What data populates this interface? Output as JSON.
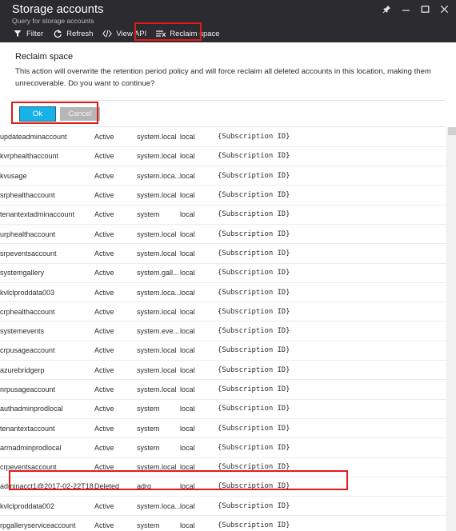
{
  "window": {
    "title": "Storage accounts",
    "subtitle": "Query for storage accounts",
    "controls": [
      {
        "name": "pin-icon",
        "label": "Pin"
      },
      {
        "name": "minimize-icon",
        "label": "Minimize"
      },
      {
        "name": "maximize-icon",
        "label": "Maximize"
      },
      {
        "name": "close-icon",
        "label": "Close"
      }
    ]
  },
  "toolbar": {
    "filter_label": "Filter",
    "refresh_label": "Refresh",
    "view_api_label": "View API",
    "reclaim_space_label": "Reclaim space"
  },
  "confirm": {
    "title": "Reclaim space",
    "message": "This action will overwrite the retention period policy and will force reclaim all deleted accounts in this location, making them unrecoverable. Do you want to continue?",
    "ok_label": "Ok",
    "cancel_label": "Cancel"
  },
  "colors": {
    "titlebar_bg": "#2b2b30",
    "ok_button": "#17b3e8",
    "cancel_button": "#b6b6b6",
    "annotation_red": "#e01b1b",
    "row_border": "#ececec"
  },
  "table": {
    "subscription_placeholder": "{Subscription ID}",
    "rows": [
      {
        "name": "updateadminaccount",
        "status": "Active",
        "group": "system.local",
        "location": "local",
        "subscription": "{Subscription ID}",
        "highlighted": false
      },
      {
        "name": "kvrphealthaccount",
        "status": "Active",
        "group": "system.local",
        "location": "local",
        "subscription": "{Subscription ID}",
        "highlighted": false
      },
      {
        "name": "kvusage",
        "status": "Active",
        "group": "system.loca...",
        "location": "local",
        "subscription": "{Subscription ID}",
        "highlighted": false
      },
      {
        "name": "srphealthaccount",
        "status": "Active",
        "group": "system.local",
        "location": "local",
        "subscription": "{Subscription ID}",
        "highlighted": false
      },
      {
        "name": "tenantextadminaccount",
        "status": "Active",
        "group": "system",
        "location": "local",
        "subscription": "{Subscription ID}",
        "highlighted": false
      },
      {
        "name": "urphealthaccount",
        "status": "Active",
        "group": "system.local",
        "location": "local",
        "subscription": "{Subscription ID}",
        "highlighted": false
      },
      {
        "name": "srpeventsaccount",
        "status": "Active",
        "group": "system.local",
        "location": "local",
        "subscription": "{Subscription ID}",
        "highlighted": false
      },
      {
        "name": "systemgallery",
        "status": "Active",
        "group": "system.gall...",
        "location": "local",
        "subscription": "{Subscription ID}",
        "highlighted": false
      },
      {
        "name": "kvlclproddata003",
        "status": "Active",
        "group": "system.loca...",
        "location": "local",
        "subscription": "{Subscription ID}",
        "highlighted": false
      },
      {
        "name": "crphealthaccount",
        "status": "Active",
        "group": "system.local",
        "location": "local",
        "subscription": "{Subscription ID}",
        "highlighted": false
      },
      {
        "name": "systemevents",
        "status": "Active",
        "group": "system.eve...",
        "location": "local",
        "subscription": "{Subscription ID}",
        "highlighted": false
      },
      {
        "name": "crpusageaccount",
        "status": "Active",
        "group": "system.local",
        "location": "local",
        "subscription": "{Subscription ID}",
        "highlighted": false
      },
      {
        "name": "azurebridgerp",
        "status": "Active",
        "group": "system.local",
        "location": "local",
        "subscription": "{Subscription ID}",
        "highlighted": false
      },
      {
        "name": "nrpusageaccount",
        "status": "Active",
        "group": "system.local",
        "location": "local",
        "subscription": "{Subscription ID}",
        "highlighted": false
      },
      {
        "name": "authadminprodlocal",
        "status": "Active",
        "group": "system",
        "location": "local",
        "subscription": "{Subscription ID}",
        "highlighted": false
      },
      {
        "name": "tenantextaccount",
        "status": "Active",
        "group": "system",
        "location": "local",
        "subscription": "{Subscription ID}",
        "highlighted": false
      },
      {
        "name": "armadminprodlocal",
        "status": "Active",
        "group": "system",
        "location": "local",
        "subscription": "{Subscription ID}",
        "highlighted": false
      },
      {
        "name": "crpeventsaccount",
        "status": "Active",
        "group": "system.local",
        "location": "local",
        "subscription": "{Subscription ID}",
        "highlighted": false
      },
      {
        "name": "adminacct1@2017-02-22T18...",
        "status": "Deleted",
        "group": "adrg",
        "location": "local",
        "subscription": "{Subscription ID}",
        "highlighted": true
      },
      {
        "name": "kvlclproddata002",
        "status": "Active",
        "group": "system.loca...",
        "location": "local",
        "subscription": "{Subscription ID}",
        "highlighted": false
      },
      {
        "name": "rpgalleryserviceaccount",
        "status": "Active",
        "group": "system",
        "location": "local",
        "subscription": "{Subscription ID}",
        "highlighted": false
      }
    ]
  }
}
